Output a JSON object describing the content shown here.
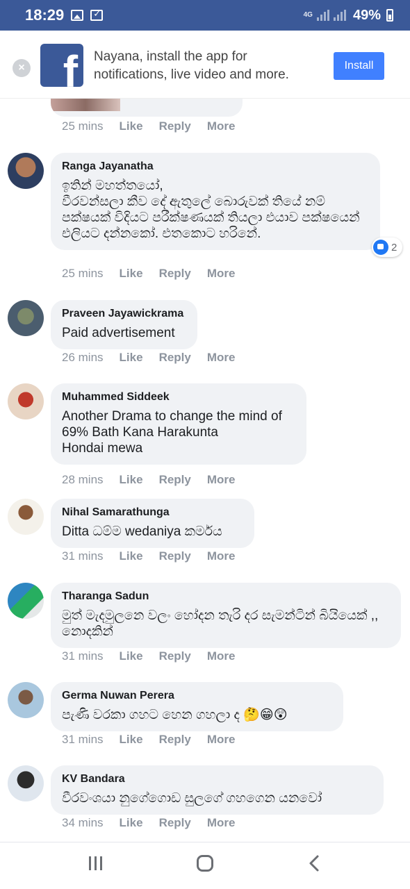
{
  "status": {
    "time": "18:29",
    "network": "4G",
    "battery": "49%"
  },
  "banner": {
    "text": "Nayana, install the app for notifications, live video and more.",
    "install_label": "Install",
    "logo_letter": "f"
  },
  "action_labels": {
    "like": "Like",
    "reply": "Reply",
    "more": "More"
  },
  "previous_comment": {
    "time": "25 mins"
  },
  "comments": [
    {
      "author": "Ranga Jayanatha",
      "text": "ඉතින් මහත්තයෝ,\nවීරවන්සලා කීව දේ ඇතුලේ බොරුවක් තියේ නම් පක්ෂයක් විදියට පරීක්ෂණයක් තියලා එයාව පක්ෂයෙන් එලියට දන්නකෝ. එතකොට හරිනේ.",
      "time": "25 mins",
      "reactions": "2"
    },
    {
      "author": "Praveen Jayawickrama",
      "text": "Paid advertisement",
      "time": "26 mins"
    },
    {
      "author": "Muhammed Siddeek",
      "text": "Another Drama to change the mind of\n69% Bath Kana Harakunta\nHondai mewa",
      "time": "28 mins"
    },
    {
      "author": "Nihal Samarathunga",
      "text": "Ditta ධම්ම wedaniya කර්මය",
      "time": "31 mins"
    },
    {
      "author": "Tharanga Sadun",
      "text": "මුත් මැදමුලනෙ වලං හෝදන තැරි දර සැමන්ටින් බියියෙක් ,, නොදකින්",
      "time": "31 mins"
    },
    {
      "author": "Germa Nuwan Perera",
      "text": "පැණි වරකා ගහට හෙන ගහලා ද 🤔😁😲",
      "time": "31 mins"
    },
    {
      "author": "KV Bandara",
      "text": "වීරවංශයා නුගේගොඩ සුලගේ ගහගෙන යනවෝ",
      "time": "34 mins"
    }
  ],
  "colors": {
    "brand": "#3b5998",
    "accent": "#4080ff",
    "bubble": "#f0f2f5",
    "meta": "#8d949e"
  }
}
